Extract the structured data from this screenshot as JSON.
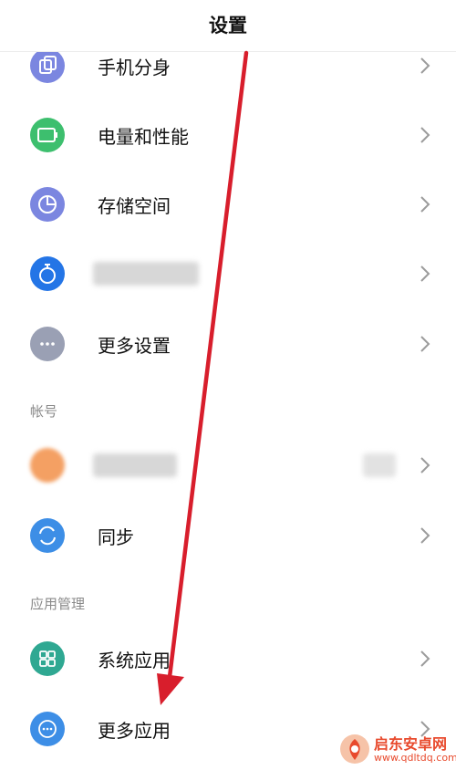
{
  "header": {
    "title": "设置"
  },
  "colors": {
    "arrow": "#d81e2c",
    "clone": "#7b86e0",
    "battery": "#3dbf6e",
    "storage": "#7b86e0",
    "blurred_app": "#2475e6",
    "more": "#9aa0b4",
    "avatar": "#f4a063",
    "sync": "#3d8ee6",
    "system_apps": "#2fa892",
    "more_apps": "#3d8ee6"
  },
  "rows": [
    {
      "label": "手机分身",
      "icon": "clone-icon"
    },
    {
      "label": "电量和性能",
      "icon": "battery-icon"
    },
    {
      "label": "存储空间",
      "icon": "pie-chart-icon"
    },
    {
      "label": "",
      "icon": "stopwatch-icon"
    },
    {
      "label": "更多设置",
      "icon": "ellipsis-icon"
    }
  ],
  "sections": {
    "account": "帐号",
    "app_management": "应用管理"
  },
  "account_rows": [
    {
      "label": "",
      "icon": "avatar"
    },
    {
      "label": "同步",
      "icon": "sync-icon"
    }
  ],
  "app_rows": [
    {
      "label": "系统应用",
      "icon": "grid-icon"
    },
    {
      "label": "更多应用",
      "icon": "dots-circle-icon"
    }
  ],
  "watermark": {
    "name": "启东安卓网",
    "url": "www.qdltdq.com"
  }
}
